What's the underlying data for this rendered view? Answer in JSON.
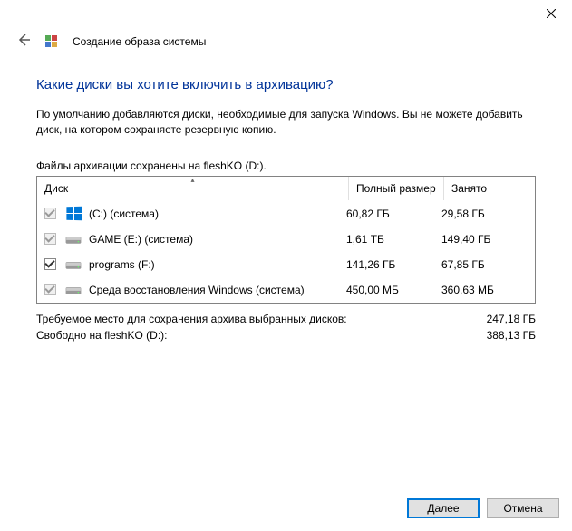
{
  "titlebar": {
    "close_label": "Close"
  },
  "header": {
    "back_label": "Back",
    "title": "Создание образа системы"
  },
  "main": {
    "question": "Какие диски вы хотите включить в архивацию?",
    "description": "По умолчанию добавляются диски, необходимые для запуска Windows. Вы не можете добавить диск, на котором сохраняете резервную копию.",
    "files_saved": "Файлы архивации сохранены на fleshKO (D:).",
    "columns": {
      "disk": "Диск",
      "size": "Полный размер",
      "used": "Занято"
    },
    "disks": [
      {
        "name": "(C:) (система)",
        "size": "60,82 ГБ",
        "used": "29,58 ГБ",
        "checked": true,
        "disabled": true,
        "icon": "windows"
      },
      {
        "name": "GAME (E:) (система)",
        "size": "1,61 ТБ",
        "used": "149,40 ГБ",
        "checked": true,
        "disabled": true,
        "icon": "hdd"
      },
      {
        "name": "programs (F:)",
        "size": "141,26 ГБ",
        "used": "67,85 ГБ",
        "checked": true,
        "disabled": false,
        "icon": "hdd"
      },
      {
        "name": "Среда восстановления Windows (система)",
        "size": "450,00 МБ",
        "used": "360,63 МБ",
        "checked": true,
        "disabled": true,
        "icon": "hdd"
      }
    ],
    "summary": {
      "required_label": "Требуемое место для сохранения архива выбранных дисков:",
      "required_value": "247,18 ГБ",
      "free_label": "Свободно на fleshKO (D:):",
      "free_value": "388,13 ГБ"
    }
  },
  "footer": {
    "next": "Далее",
    "cancel": "Отмена"
  }
}
